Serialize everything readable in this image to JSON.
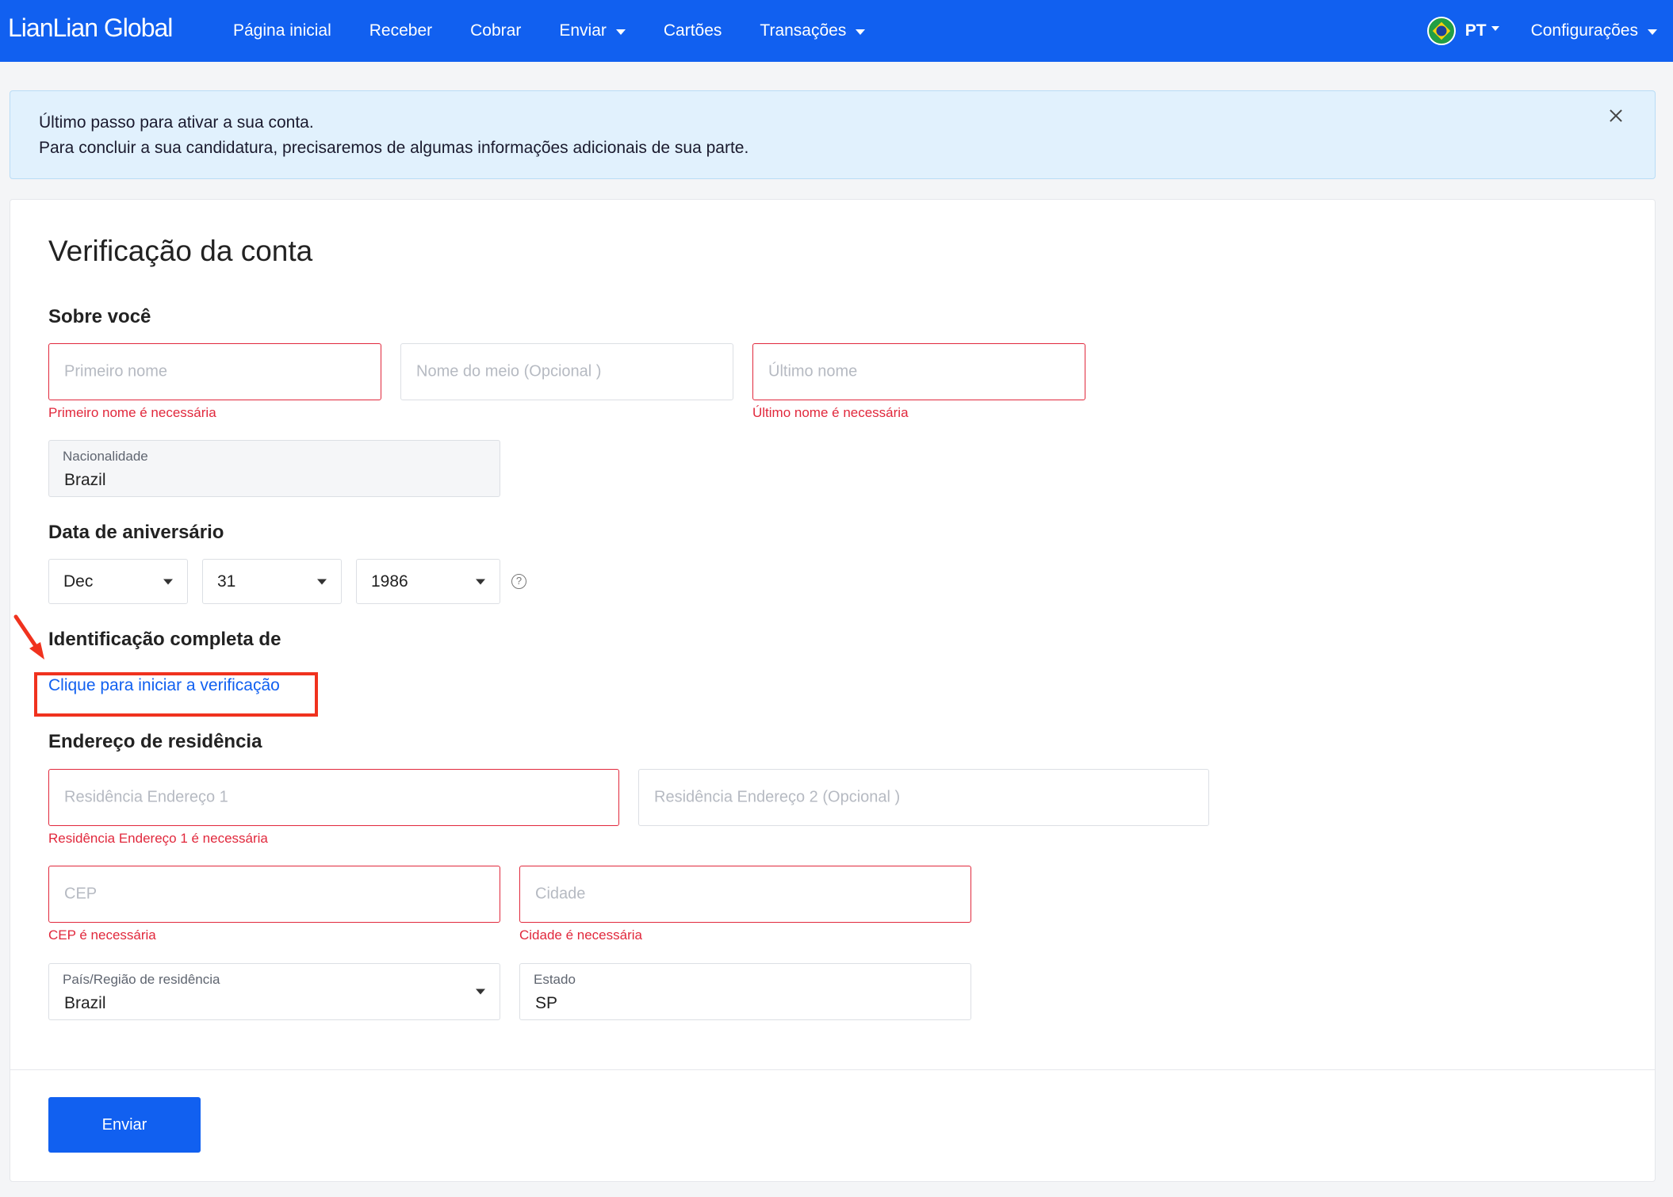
{
  "nav": {
    "logo": "LianLian Global",
    "items": [
      {
        "label": "Página inicial",
        "dropdown": false
      },
      {
        "label": "Receber",
        "dropdown": false
      },
      {
        "label": "Cobrar",
        "dropdown": false
      },
      {
        "label": "Enviar",
        "dropdown": true
      },
      {
        "label": "Cartões",
        "dropdown": false
      },
      {
        "label": "Transações",
        "dropdown": true
      }
    ],
    "language": "PT",
    "settings": "Configurações"
  },
  "banner": {
    "title": "Último passo para ativar a sua conta.",
    "text": "Para concluir a sua candidatura, precisaremos de algumas informações adicionais de sua parte."
  },
  "form": {
    "title": "Verificação da conta",
    "about": {
      "heading": "Sobre você",
      "first_name_placeholder": "Primeiro nome",
      "first_name_error": "Primeiro nome é necessária",
      "middle_name_placeholder": "Nome do meio (Opcional )",
      "last_name_placeholder": "Último nome",
      "last_name_error": "Último nome é necessária",
      "nationality_label": "Nacionalidade",
      "nationality_value": "Brazil"
    },
    "birthday": {
      "heading": "Data de aniversário",
      "month": "Dec",
      "day": "31",
      "year": "1986",
      "help": "?"
    },
    "identification": {
      "heading": "Identificação completa de",
      "link": "Clique para iniciar a verificação"
    },
    "address": {
      "heading": "Endereço de residência",
      "line1_placeholder": "Residência Endereço 1",
      "line1_error": "Residência Endereço 1 é necessária",
      "line2_placeholder": "Residência Endereço 2 (Opcional )",
      "zip_placeholder": "CEP",
      "zip_error": "CEP é necessária",
      "city_placeholder": "Cidade",
      "city_error": "Cidade é necessária",
      "country_label": "País/Região de residência",
      "country_value": "Brazil",
      "state_label": "Estado",
      "state_value": "SP"
    },
    "submit": "Enviar"
  },
  "colors": {
    "brand": "#1160f0",
    "error": "#e1283c",
    "annotation": "#f0321e"
  }
}
